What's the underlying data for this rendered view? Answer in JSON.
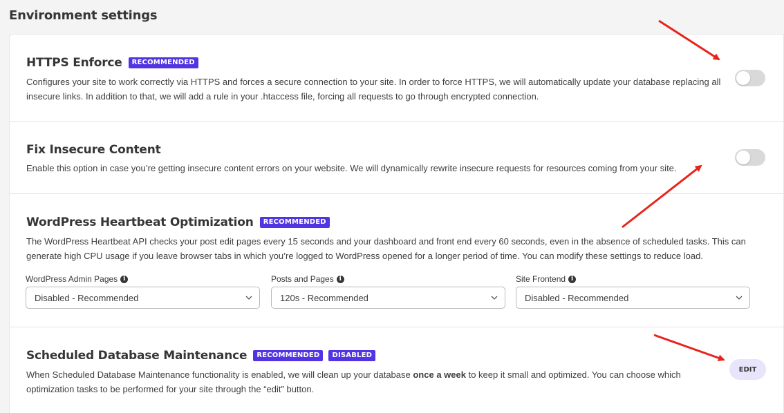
{
  "page": {
    "title": "Environment settings"
  },
  "colors": {
    "recommended_badge": "#5334e3",
    "disabled_badge": "#5334e3",
    "arrow": "#e8231b",
    "toggle_off": "#d9d9d9",
    "edit_button_bg": "#e7e4fb"
  },
  "sections": {
    "https": {
      "title": "HTTPS Enforce",
      "badge": "RECOMMENDED",
      "desc_line1": "Configures your site to work correctly via HTTPS and forces a secure connection to your site. In order to force HTTPS, we will automatically update your database replacing all",
      "desc_line2": "insecure links. In addition to that, we will add a rule in your .htaccess file, forcing all requests to go through encrypted connection.",
      "toggle_state": "off"
    },
    "insecure": {
      "title": "Fix Insecure Content",
      "desc_line1": "Enable this option in case you’re getting insecure content errors on your website. We will dynamically rewrite insecure requests for resources coming from your site.",
      "toggle_state": "off"
    },
    "heartbeat": {
      "title": "WordPress Heartbeat Optimization",
      "badge": "RECOMMENDED",
      "desc_line1": "The WordPress Heartbeat API checks your post edit pages every 15 seconds and your dashboard and front end every 60 seconds, even in the absence of scheduled tasks. This can",
      "desc_line2": "generate high CPU usage if you leave browser tabs in which you’re logged to WordPress opened for a longer period of time. You can modify these settings to reduce load.",
      "fields": [
        {
          "label": "WordPress Admin Pages",
          "value": "Disabled - Recommended"
        },
        {
          "label": "Posts and Pages",
          "value": "120s - Recommended"
        },
        {
          "label": "Site Frontend",
          "value": "Disabled - Recommended"
        }
      ],
      "info_icon": "info-icon",
      "chevron_icon": "chevron-down-icon"
    },
    "maintenance": {
      "title": "Scheduled Database Maintenance",
      "badge_recommended": "RECOMMENDED",
      "badge_disabled": "DISABLED",
      "desc_part1": "When Scheduled Database Maintenance functionality is enabled, we will clean up your database ",
      "desc_bold": "once a week",
      "desc_part2": " to keep it small and optimized. You can choose which",
      "desc_line2": "optimization tasks to be performed for your site through the “edit” button.",
      "edit_label": "EDIT"
    }
  }
}
